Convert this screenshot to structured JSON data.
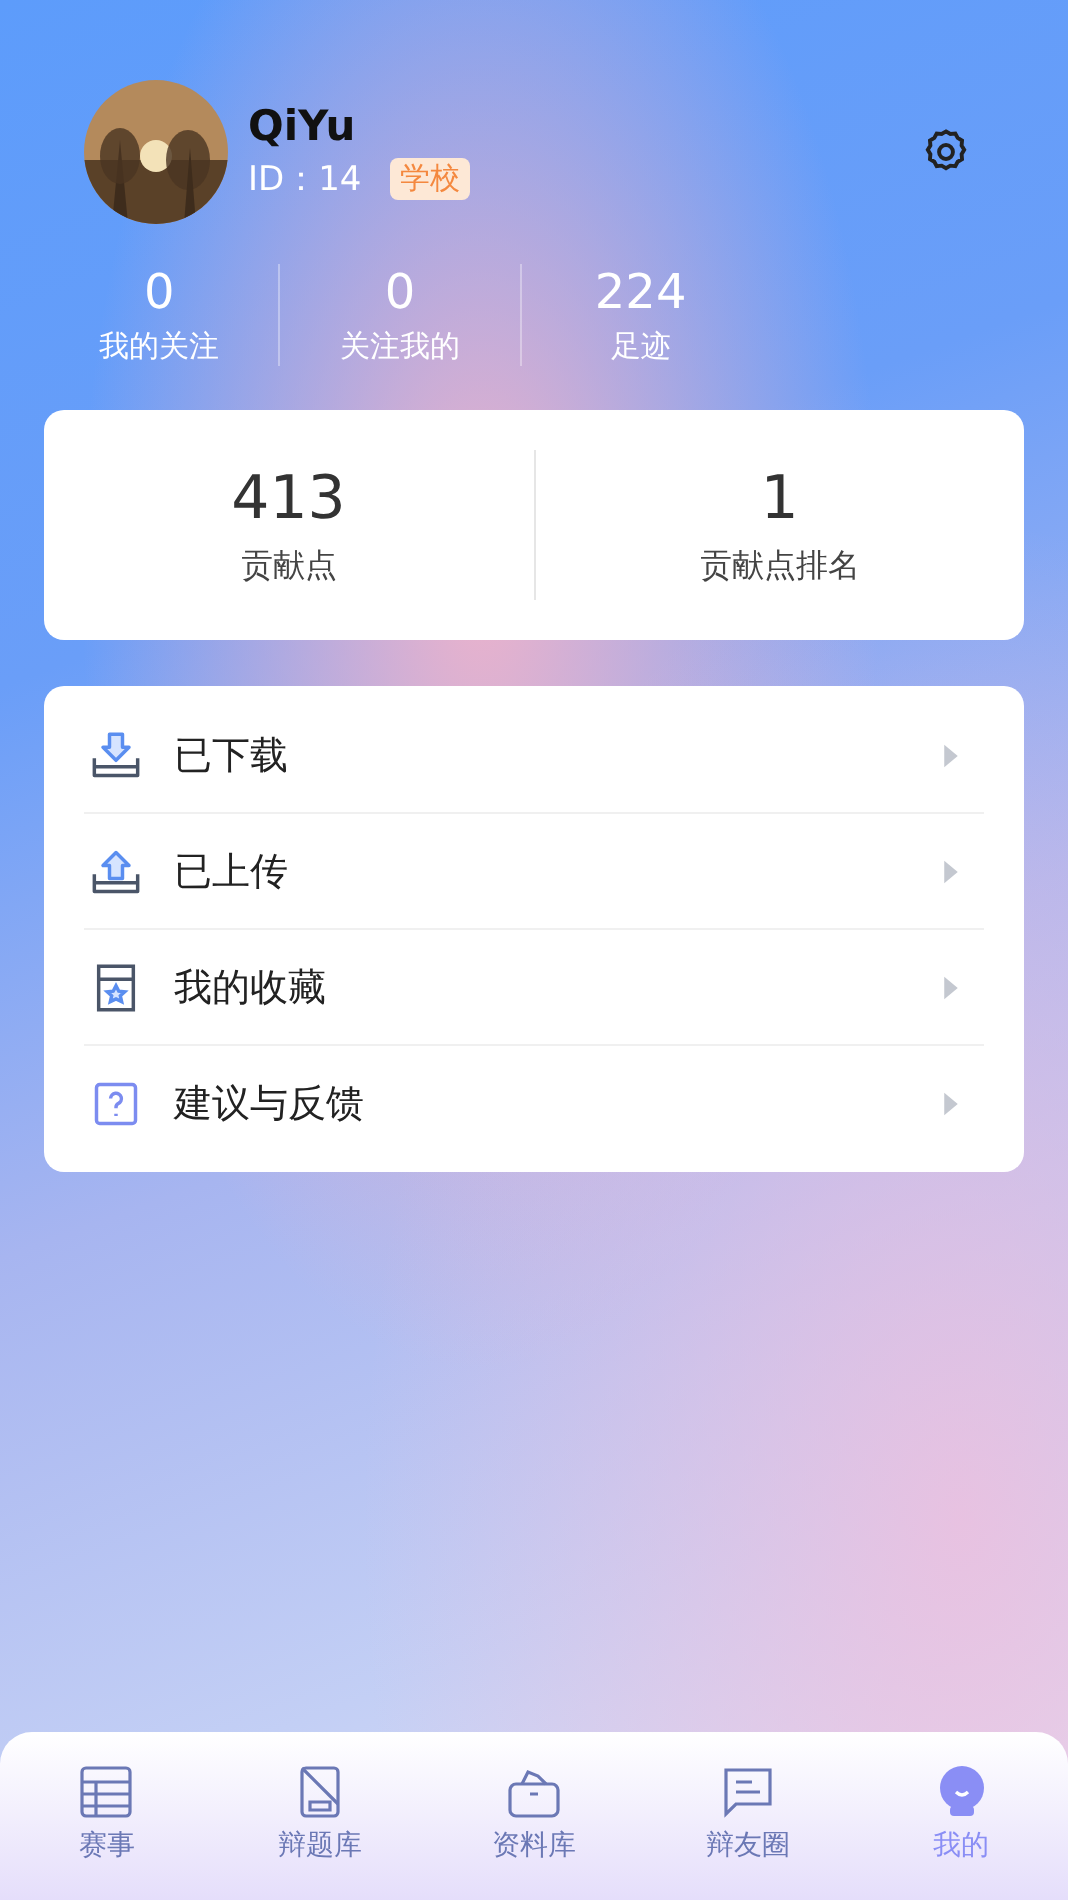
{
  "profile": {
    "name": "QiYu",
    "id_label": "ID：14",
    "badge": "学校"
  },
  "stats": [
    {
      "value": "0",
      "label": "我的关注"
    },
    {
      "value": "0",
      "label": "关注我的"
    },
    {
      "value": "224",
      "label": "足迹"
    }
  ],
  "contribution": [
    {
      "value": "413",
      "label": "贡献点"
    },
    {
      "value": "1",
      "label": "贡献点排名"
    }
  ],
  "menu": [
    {
      "kind": "download",
      "label": "已下载"
    },
    {
      "kind": "upload",
      "label": "已上传"
    },
    {
      "kind": "favorite",
      "label": "我的收藏"
    },
    {
      "kind": "feedback",
      "label": "建议与反馈"
    }
  ],
  "tabs": [
    {
      "kind": "events",
      "label": "赛事",
      "selected": false
    },
    {
      "kind": "questions",
      "label": "辩题库",
      "selected": false
    },
    {
      "kind": "materials",
      "label": "资料库",
      "selected": false
    },
    {
      "kind": "community",
      "label": "辩友圈",
      "selected": false
    },
    {
      "kind": "me",
      "label": "我的",
      "selected": true
    }
  ]
}
